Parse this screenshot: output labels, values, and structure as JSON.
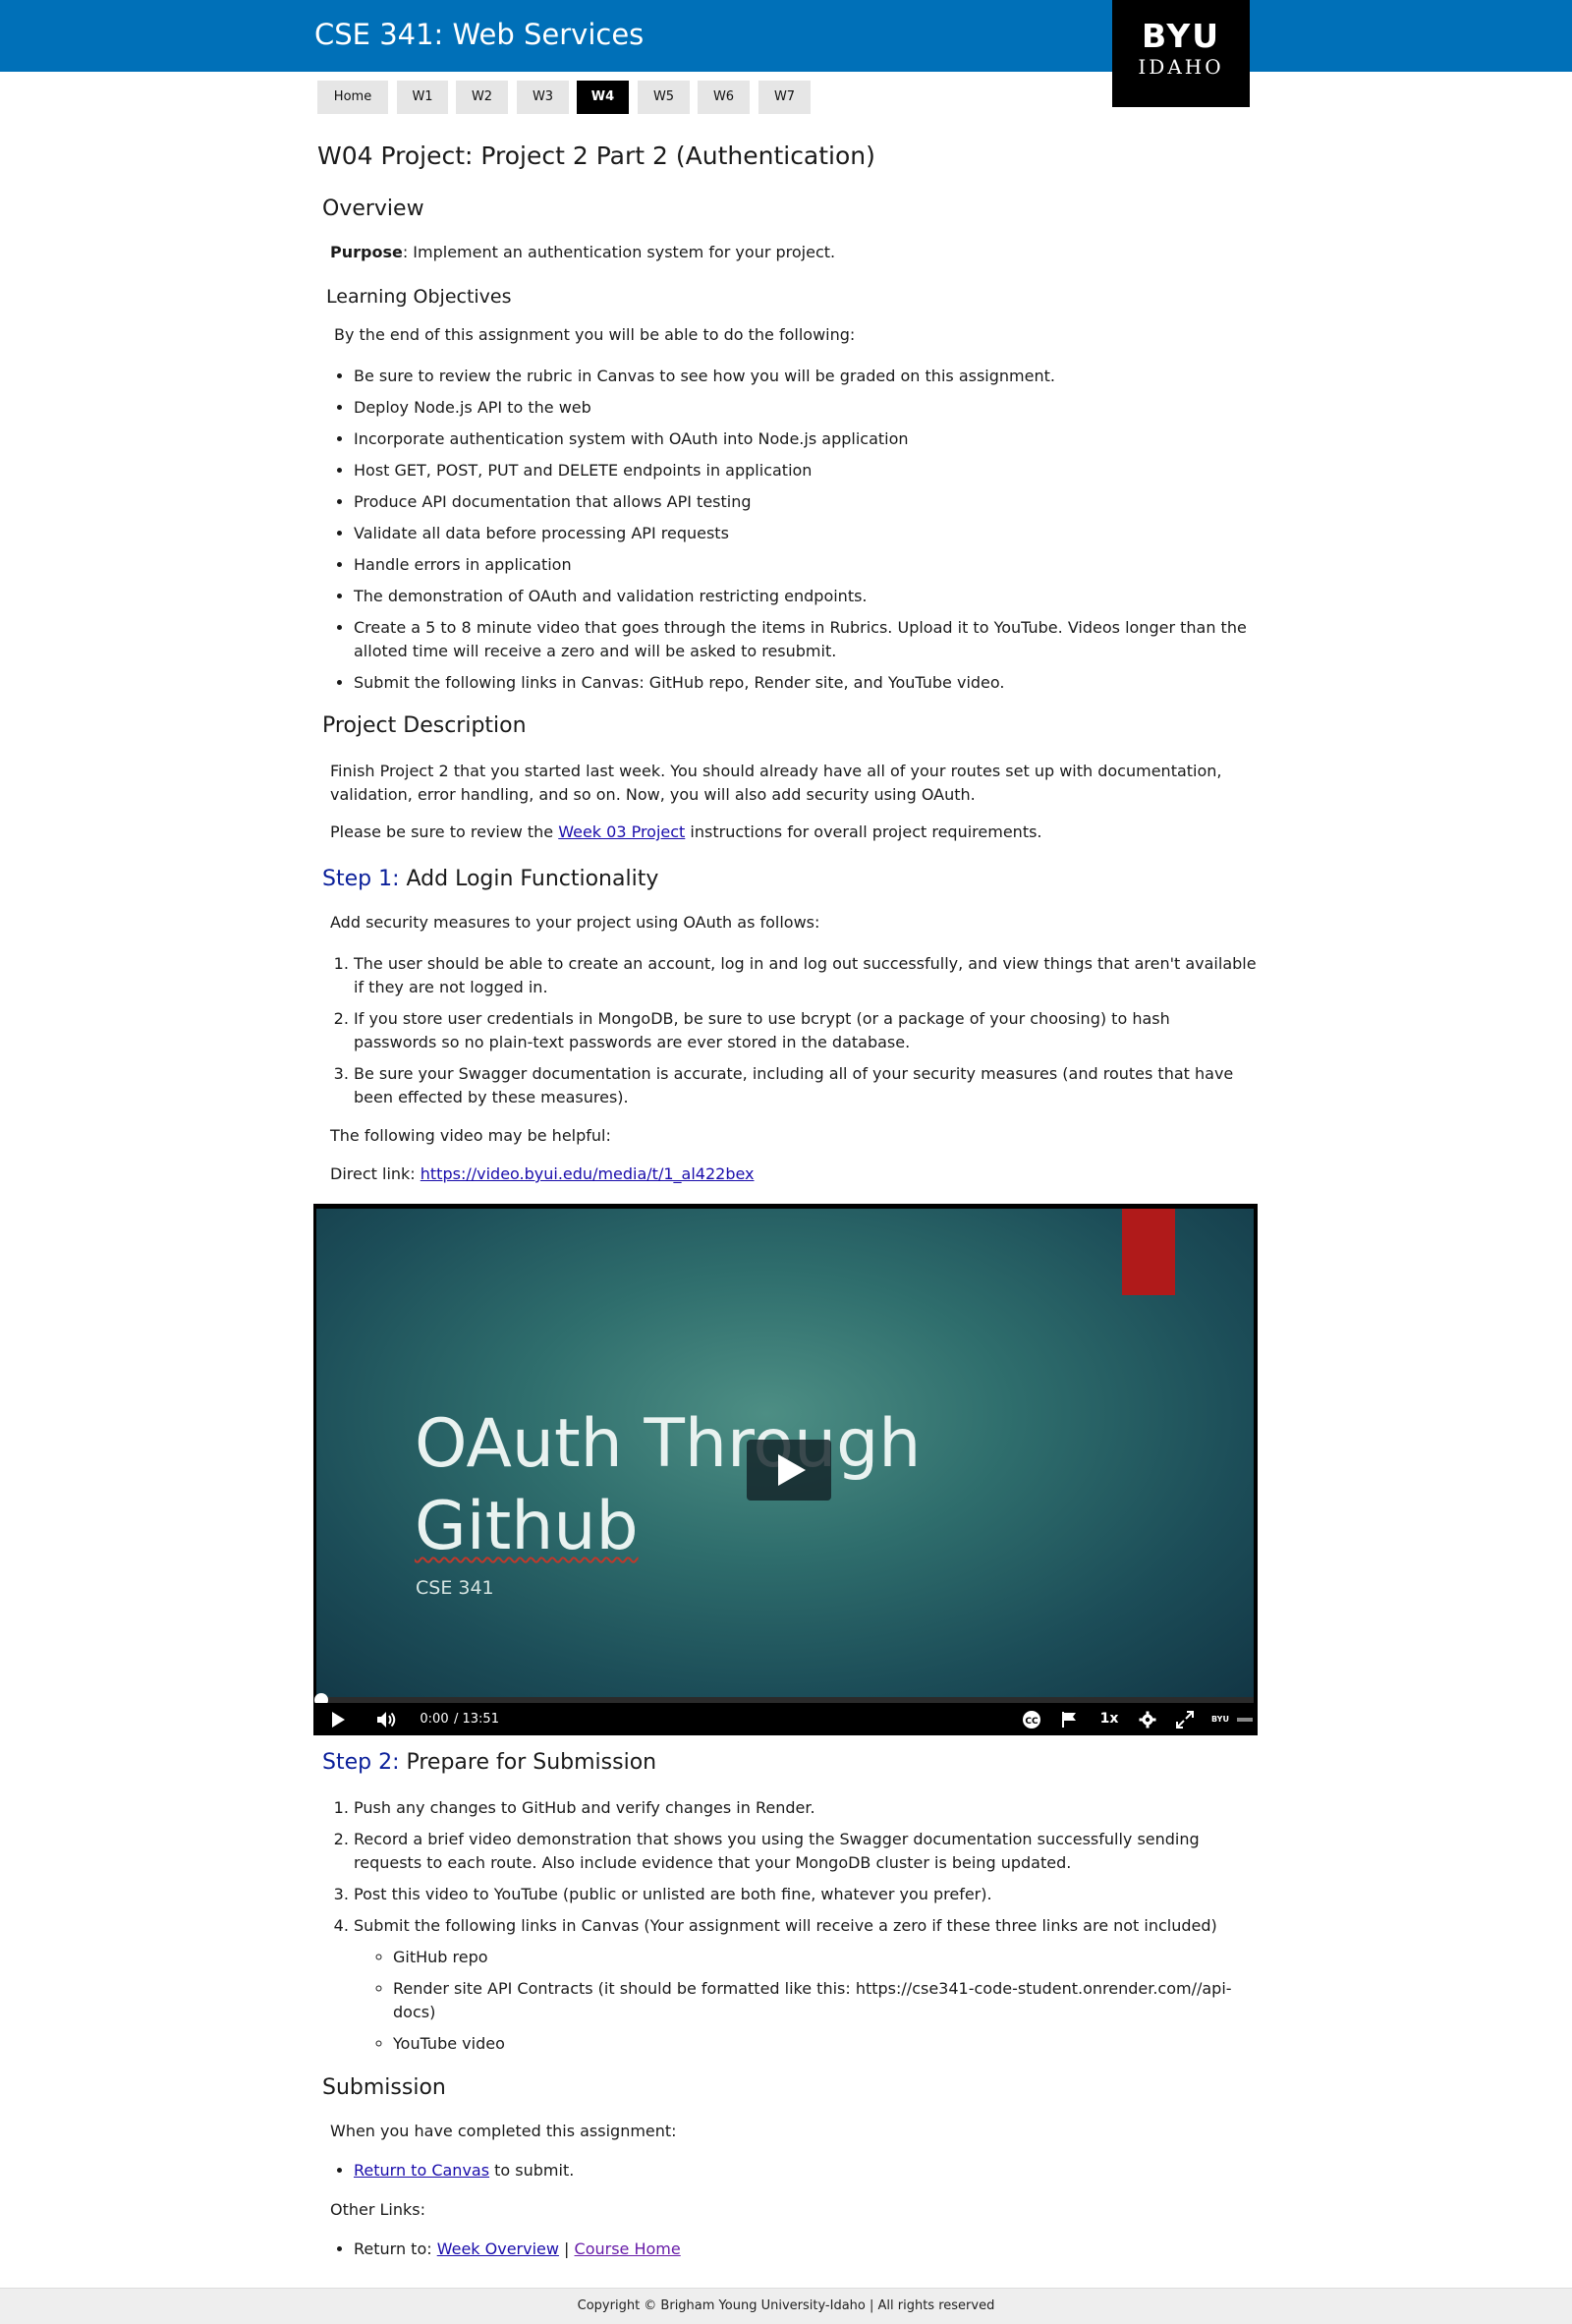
{
  "header": {
    "title": "CSE 341: Web Services",
    "logo_top": "BYU",
    "logo_bottom": "IDAHO"
  },
  "nav": {
    "tabs": [
      "Home",
      "W1",
      "W2",
      "W3",
      "W4",
      "W5",
      "W6",
      "W7"
    ],
    "active": "W4"
  },
  "page_title": "W04 Project: Project 2 Part 2 (Authentication)",
  "overview": {
    "heading": "Overview",
    "purpose_label": "Purpose",
    "purpose_text": ": Implement an authentication system for your project.",
    "objectives_heading": "Learning Objectives",
    "objectives_intro": "By the end of this assignment you will be able to do the following:",
    "objectives": [
      "Be sure to review the rubric in Canvas to see how you will be graded on this assignment.",
      "Deploy Node.js API to the web",
      "Incorporate authentication system with OAuth into Node.js application",
      "Host GET, POST, PUT and DELETE endpoints in application",
      "Produce API documentation that allows API testing",
      "Validate all data before processing API requests",
      "Handle errors in application",
      "The demonstration of OAuth and validation restricting endpoints.",
      "Create a 5 to 8 minute video that goes through the items in Rubrics. Upload it to YouTube. Videos longer than the alloted time will receive a zero and will be asked to resubmit.",
      "Submit the following links in Canvas: GitHub repo, Render site, and YouTube video."
    ]
  },
  "project_description": {
    "heading": "Project Description",
    "p1": "Finish Project 2 that you started last week. You should already have all of your routes set up with documentation, validation, error handling, and so on. Now, you will also add security using OAuth.",
    "p2_before": "Please be sure to review the ",
    "p2_link": "Week 03 Project",
    "p2_after": " instructions for overall project requirements."
  },
  "step1": {
    "label": "Step 1:",
    "title": " Add Login Functionality",
    "intro": "Add security measures to your project using OAuth as follows:",
    "items": [
      "The user should be able to create an account, log in and log out successfully, and view things that aren't available if they are not logged in.",
      "If you store user credentials in MongoDB, be sure to use bcrypt (or a package of your choosing) to hash passwords so no plain-text passwords are ever stored in the database.",
      "Be sure your Swagger documentation is accurate, including all of your security measures (and routes that have been effected by these measures)."
    ],
    "video_note": "The following video may be helpful:",
    "direct_label": "Direct link: ",
    "direct_url": "https://video.byui.edu/media/t/1_al422bex"
  },
  "video": {
    "slide_title_line1": "OAuth Through",
    "slide_title_line2": "Github",
    "slide_subtitle": "CSE 341",
    "time_current": "0:00",
    "time_total": "/ 13:51",
    "speed": "1x",
    "progress": 0.0,
    "brand": "BYU"
  },
  "step2": {
    "label": "Step 2:",
    "title": " Prepare for Submission",
    "items": [
      "Push any changes to GitHub and verify changes in Render.",
      "Record a brief video demonstration that shows you using the Swagger documentation successfully sending requests to each route. Also include evidence that your MongoDB cluster is being updated.",
      "Post this video to YouTube (public or unlisted are both fine, whatever you prefer).",
      "Submit the following links in Canvas (Your assignment will receive a zero if these three links are not included)"
    ],
    "subitems": [
      "GitHub repo",
      "Render site API Contracts (it should be formatted like this: https://cse341-code-student.onrender.com//api-docs)",
      "YouTube video"
    ]
  },
  "submission": {
    "heading": "Submission",
    "intro": "When you have completed this assignment:",
    "canvas_link": "Return to Canvas",
    "canvas_after": " to submit.",
    "other_links": "Other Links:",
    "return_to": "Return to: ",
    "week_overview": "Week Overview",
    "separator": " | ",
    "course_home": "Course Home"
  },
  "footer": {
    "text": "Copyright © Brigham Young University-Idaho | All rights reserved"
  },
  "colors": {
    "header_blue": "#0070b8",
    "step_blue": "#0a1f9a",
    "link": "#1a0dab",
    "bookmark_red": "#b01a1a"
  }
}
